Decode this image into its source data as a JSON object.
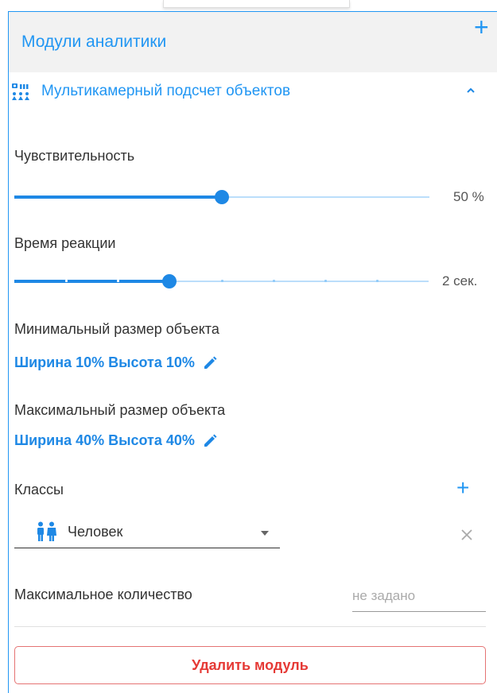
{
  "panel": {
    "title": "Модули аналитики"
  },
  "module": {
    "title": "Мультикамерный подсчет объектов",
    "icon": "multicamera-count-icon"
  },
  "sensitivity": {
    "label": "Чувствительность",
    "value": "50 %",
    "fraction": 0.5
  },
  "reaction_time": {
    "label": "Время реакции",
    "value": "2 сек.",
    "steps": 8,
    "selected_step": 3
  },
  "min_size": {
    "label": "Минимальный размер объекта",
    "value": "Ширина 10% Высота 10%"
  },
  "max_size": {
    "label": "Максимальный размер объекта",
    "value": "Ширина 40% Высота 40%"
  },
  "classes": {
    "label": "Классы",
    "selected": "Человек",
    "icon": "person-icon"
  },
  "max_count": {
    "label": "Максимальное количество",
    "placeholder": "не задано"
  },
  "actions": {
    "delete_label": "Удалить модуль"
  },
  "colors": {
    "accent": "#2196f3",
    "danger": "#e53935",
    "header_bg": "#f2f2f2"
  }
}
